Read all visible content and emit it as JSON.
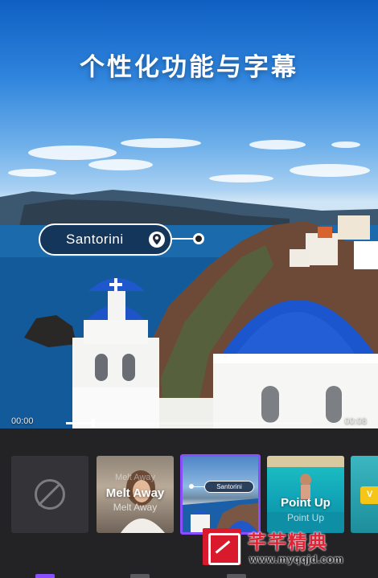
{
  "headline": "个性化功能与字幕",
  "location_sticker": {
    "label": "Santorini"
  },
  "timeline": {
    "start": "00:00",
    "end": "00:08",
    "progress_fraction": 0.11
  },
  "templates": [
    {
      "id": "none",
      "icon": "none-icon"
    },
    {
      "id": "melt-away",
      "title": "Melt Away",
      "subtitle": "Melt Away",
      "ghost": "Melt Away"
    },
    {
      "id": "santorini",
      "label": "Santorini",
      "selected": true
    },
    {
      "id": "point-up",
      "title": "Point Up",
      "subtitle": "Point Up"
    },
    {
      "id": "partial",
      "badge": "V"
    }
  ],
  "watermark": {
    "title": "芊芊精典",
    "url": "www.myqqjd.com"
  },
  "colors": {
    "accent": "#8a4dff",
    "panel": "#232326",
    "watermark": "#e02437"
  }
}
